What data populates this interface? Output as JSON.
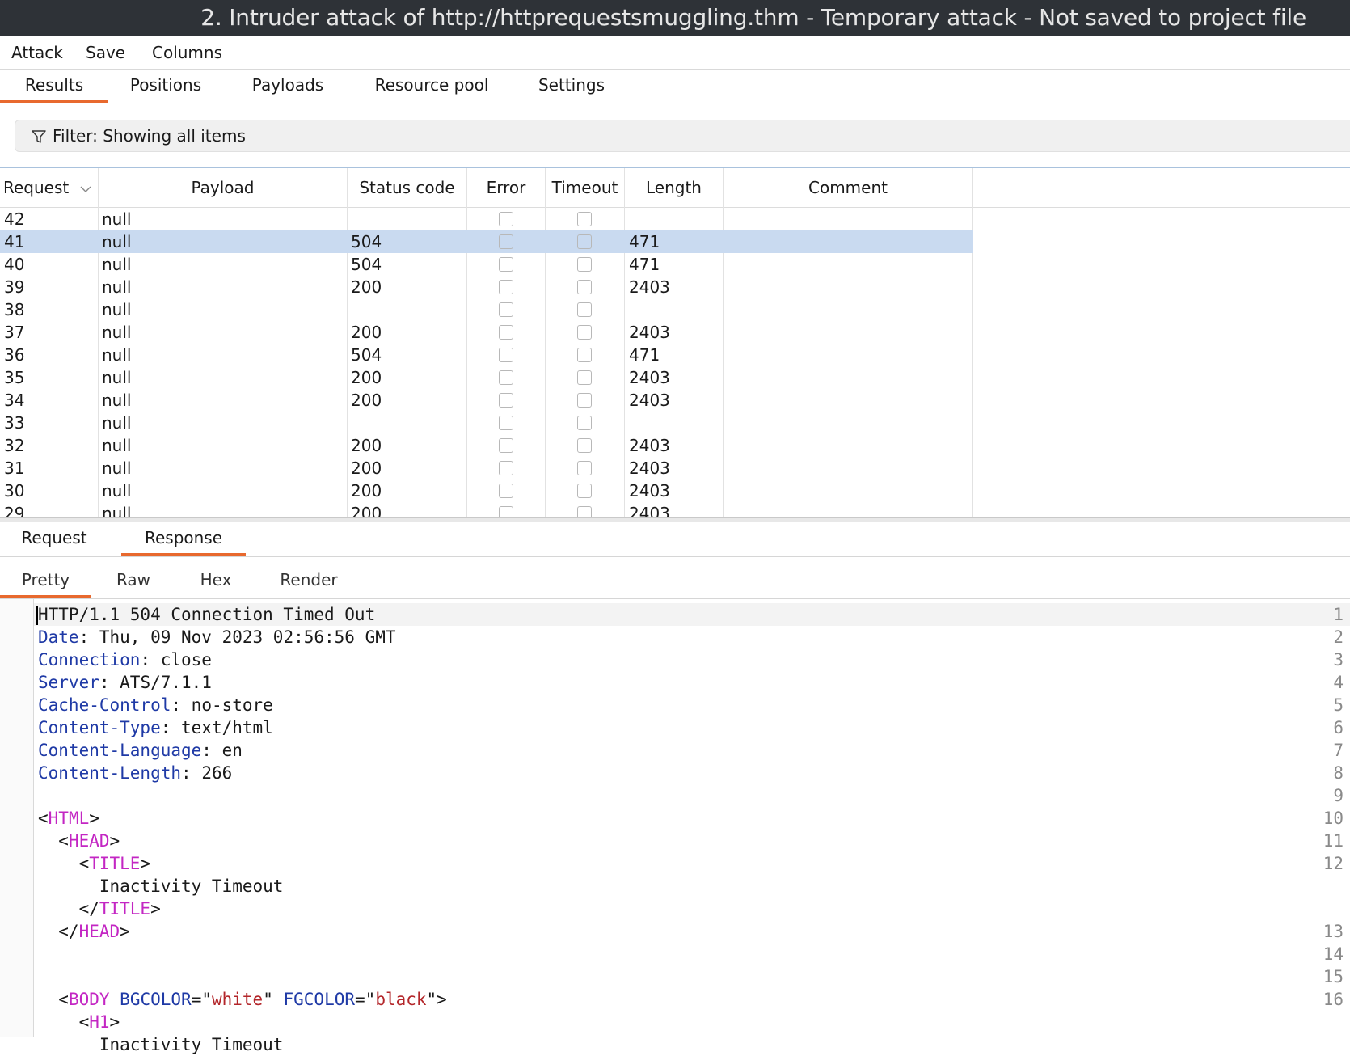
{
  "window": {
    "title": "2. Intruder attack of http://httprequestsmuggling.thm - Temporary attack - Not saved to project file"
  },
  "menu": [
    "Attack",
    "Save",
    "Columns"
  ],
  "main_tabs": [
    "Results",
    "Positions",
    "Payloads",
    "Resource pool",
    "Settings"
  ],
  "main_tab_active": "Results",
  "filter": {
    "label": "Filter: Showing all items"
  },
  "table": {
    "columns": [
      "Request",
      "Payload",
      "Status code",
      "Error",
      "Timeout",
      "Length",
      "Comment"
    ],
    "sort_column": "Request",
    "selected_request": "41",
    "rows": [
      {
        "request": "42",
        "payload": "null",
        "status": "",
        "length": ""
      },
      {
        "request": "41",
        "payload": "null",
        "status": "504",
        "length": "471"
      },
      {
        "request": "40",
        "payload": "null",
        "status": "504",
        "length": "471"
      },
      {
        "request": "39",
        "payload": "null",
        "status": "200",
        "length": "2403"
      },
      {
        "request": "38",
        "payload": "null",
        "status": "",
        "length": ""
      },
      {
        "request": "37",
        "payload": "null",
        "status": "200",
        "length": "2403"
      },
      {
        "request": "36",
        "payload": "null",
        "status": "504",
        "length": "471"
      },
      {
        "request": "35",
        "payload": "null",
        "status": "200",
        "length": "2403"
      },
      {
        "request": "34",
        "payload": "null",
        "status": "200",
        "length": "2403"
      },
      {
        "request": "33",
        "payload": "null",
        "status": "",
        "length": ""
      },
      {
        "request": "32",
        "payload": "null",
        "status": "200",
        "length": "2403"
      },
      {
        "request": "31",
        "payload": "null",
        "status": "200",
        "length": "2403"
      },
      {
        "request": "30",
        "payload": "null",
        "status": "200",
        "length": "2403"
      },
      {
        "request": "29",
        "payload": "null",
        "status": "200",
        "length": "2403"
      }
    ]
  },
  "detail_tabs": [
    "Request",
    "Response"
  ],
  "detail_tab_active": "Response",
  "view_tabs": [
    "Pretty",
    "Raw",
    "Hex",
    "Render"
  ],
  "view_tab_active": "Pretty",
  "response": {
    "status_line": "HTTP/1.1 504 Connection Timed Out",
    "headers": [
      {
        "name": "Date",
        "value": "Thu, 09 Nov 2023 02:56:56 GMT"
      },
      {
        "name": "Connection",
        "value": "close"
      },
      {
        "name": "Server",
        "value": "ATS/7.1.1"
      },
      {
        "name": "Cache-Control",
        "value": "no-store"
      },
      {
        "name": "Content-Type",
        "value": "text/html"
      },
      {
        "name": "Content-Language",
        "value": "en"
      },
      {
        "name": "Content-Length",
        "value": "266"
      }
    ],
    "body": {
      "html_tag": "HTML",
      "head_tag": "HEAD",
      "title_tag": "TITLE",
      "title_text": "Inactivity Timeout",
      "body_tag": "BODY",
      "attr1_name": "BGCOLOR",
      "attr1_value": "white",
      "attr2_name": "FGCOLOR",
      "attr2_value": "black",
      "h1_tag": "H1",
      "h1_text": "Inactivity Timeout"
    }
  },
  "line_numbers": [
    "1",
    "2",
    "3",
    "4",
    "5",
    "6",
    "7",
    "8",
    "9",
    "10",
    "11",
    "12",
    "13",
    "14",
    "15",
    "16"
  ],
  "colors": {
    "accent": "#e8692e",
    "selected_row": "#c9daf0",
    "header_key": "#1f3aa6",
    "tag": "#c326c3",
    "attr_value": "#b3262a",
    "titlebar": "#2e3237"
  }
}
